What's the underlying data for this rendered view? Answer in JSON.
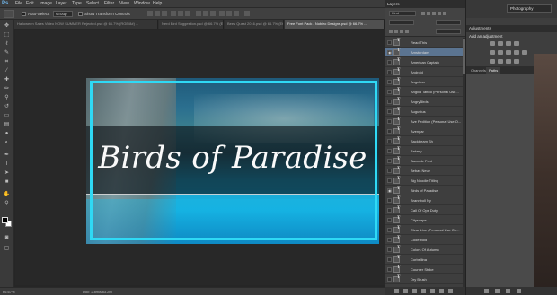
{
  "menubar": {
    "logo": "Ps",
    "items": [
      "File",
      "Edit",
      "Image",
      "Layer",
      "Type",
      "Select",
      "Filter",
      "View",
      "Window",
      "Help"
    ]
  },
  "options_bar": {
    "auto_select_label": "Auto-Select:",
    "auto_select_value": "Group",
    "show_transform_label": "Show Transform Controls"
  },
  "doc_tabs": [
    {
      "label": "Halloween Sales Video NOW SUMMER Rejected.psd @ 66.7% (RGB/8#) ...",
      "active": false
    },
    {
      "label": "Nerd Bird Suggestion.psd @ 66.7% (Effect(s) Layer 1, RGB/8)",
      "active": false
    },
    {
      "label": "Bees Quest 2016.psd @ 66.7% (Effect(s) Layer 1, RGB/8)",
      "active": false
    },
    {
      "label": "Free Font Pack - Nobizo Designs.psd @ 66.7% ...",
      "active": true
    }
  ],
  "canvas": {
    "title_text": "Birds of Paradise"
  },
  "status": {
    "zoom": "66.67%",
    "doc": "Doc: 2.89M/83.2M"
  },
  "layers_panel": {
    "tab": "Layers",
    "filter": "Kind",
    "layers": [
      {
        "name": "Read This",
        "selected": false,
        "eye": false
      },
      {
        "name": "Amsterdam",
        "selected": true,
        "eye": true
      },
      {
        "name": "American Captain",
        "selected": false,
        "eye": false
      },
      {
        "name": "Android",
        "selected": false,
        "eye": false
      },
      {
        "name": "Angelina",
        "selected": false,
        "eye": false
      },
      {
        "name": "Angilla Tattoo (Personal Use...",
        "selected": false,
        "eye": false
      },
      {
        "name": "AngryBirds",
        "selected": false,
        "eye": false
      },
      {
        "name": "Augustus",
        "selected": false,
        "eye": false
      },
      {
        "name": "Ave Fedition (Personal Use O...",
        "selected": false,
        "eye": false
      },
      {
        "name": "Avengar",
        "selected": false,
        "eye": false
      },
      {
        "name": "Backbeam Sh",
        "selected": false,
        "eye": false
      },
      {
        "name": "Bakery",
        "selected": false,
        "eye": false
      },
      {
        "name": "Barcode Font",
        "selected": false,
        "eye": false
      },
      {
        "name": "Bebas Neue",
        "selected": false,
        "eye": false
      },
      {
        "name": "Big Noodle Titling",
        "selected": false,
        "eye": false
      },
      {
        "name": "Birds of Paradise",
        "selected": false,
        "eye": true
      },
      {
        "name": "Brannboll Ny",
        "selected": false,
        "eye": false
      },
      {
        "name": "Call Of Ops Duty",
        "selected": false,
        "eye": false
      },
      {
        "name": "Cityscape",
        "selected": false,
        "eye": false
      },
      {
        "name": "Clear Line (Personal Use On...",
        "selected": false,
        "eye": false
      },
      {
        "name": "Code bold",
        "selected": false,
        "eye": false
      },
      {
        "name": "Colors Of Autumn",
        "selected": false,
        "eye": false
      },
      {
        "name": "Corbellina",
        "selected": false,
        "eye": false
      },
      {
        "name": "Counter Strike",
        "selected": false,
        "eye": false
      },
      {
        "name": "Dry Brush",
        "selected": false,
        "eye": false
      },
      {
        "name": "Deal Breaker",
        "selected": false,
        "eye": false
      },
      {
        "name": "DS Chalk It Up",
        "selected": false,
        "eye": false
      },
      {
        "name": "Dolls",
        "selected": false,
        "eye": false
      },
      {
        "name": "Dream space",
        "selected": false,
        "eye": false
      }
    ]
  },
  "right_dock": {
    "workspace": "Photography",
    "adjustments_tab": "Adjustments",
    "add_adjustment": "Add an adjustment",
    "channels_tab": "Channels",
    "paths_tab": "Paths"
  }
}
